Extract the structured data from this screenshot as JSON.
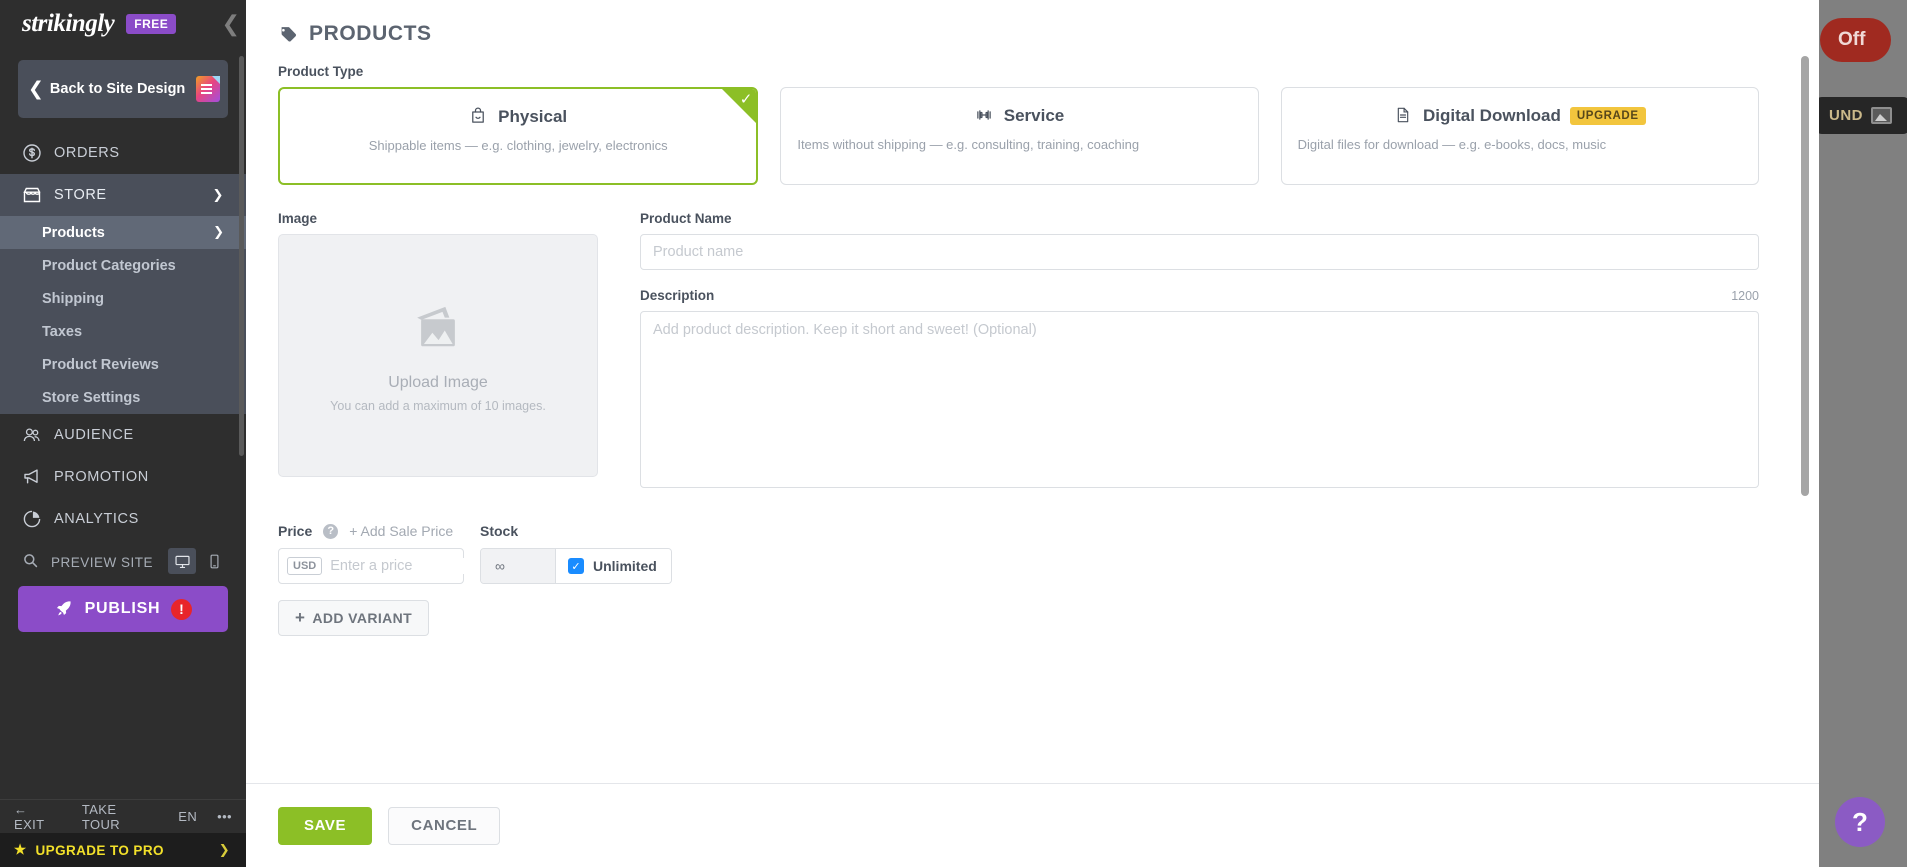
{
  "background": {
    "off_pill_label": "Off",
    "dark_button_label": "UND",
    "help_button_label": "?"
  },
  "sidebar": {
    "brand_name": "strikingly",
    "plan_badge": "FREE",
    "back_tile": {
      "label": "Back to Site Design"
    },
    "nav": [
      {
        "label": "ORDERS",
        "icon": "dollar-coin-icon",
        "active": false,
        "expanded": false
      },
      {
        "label": "STORE",
        "icon": "store-icon",
        "active": true,
        "expanded": true
      },
      {
        "label": "AUDIENCE",
        "icon": "people-icon",
        "active": false,
        "expanded": false
      },
      {
        "label": "PROMOTION",
        "icon": "megaphone-icon",
        "active": false,
        "expanded": false
      },
      {
        "label": "ANALYTICS",
        "icon": "pie-chart-icon",
        "active": false,
        "expanded": false
      }
    ],
    "store_subitems": [
      {
        "label": "Products",
        "selected": true
      },
      {
        "label": "Product Categories",
        "selected": false
      },
      {
        "label": "Shipping",
        "selected": false
      },
      {
        "label": "Taxes",
        "selected": false
      },
      {
        "label": "Product Reviews",
        "selected": false
      },
      {
        "label": "Store Settings",
        "selected": false
      }
    ],
    "preview": {
      "label": "PREVIEW SITE"
    },
    "publish": {
      "label": "PUBLISH",
      "alert": "!"
    },
    "footer": {
      "exit": "EXIT",
      "take_tour": "TAKE TOUR",
      "language": "EN",
      "more": "•••"
    },
    "upgrade": {
      "label": "UPGRADE TO PRO"
    }
  },
  "main": {
    "page_title": "PRODUCTS",
    "product_type": {
      "label": "Product Type",
      "options": [
        {
          "name": "Physical",
          "description": "Shippable items — e.g. clothing, jewelry, electronics",
          "icon": "shopping-bag-icon",
          "selected": true,
          "badge": ""
        },
        {
          "name": "Service",
          "description": "Items without shipping — e.g. consulting, training, coaching",
          "icon": "dumbbell-icon",
          "selected": false,
          "badge": ""
        },
        {
          "name": "Digital Download",
          "description": "Digital files for download — e.g. e-books, docs, music",
          "icon": "document-icon",
          "selected": false,
          "badge": "UPGRADE"
        }
      ]
    },
    "image": {
      "label": "Image",
      "upload_title": "Upload Image",
      "upload_hint": "You can add a maximum of 10 images."
    },
    "product_name": {
      "label": "Product Name",
      "placeholder": "Product name",
      "value": ""
    },
    "description": {
      "label": "Description",
      "char_limit": "1200",
      "placeholder": "Add product description. Keep it short and sweet! (Optional)",
      "value": ""
    },
    "price": {
      "label": "Price",
      "help": "?",
      "add_sale_price": "+ Add Sale Price",
      "currency": "USD",
      "placeholder": "Enter a price",
      "value": ""
    },
    "stock": {
      "label": "Stock",
      "quantity": "∞",
      "unlimited_label": "Unlimited",
      "unlimited_checked": true
    },
    "add_variant_label": "ADD VARIANT",
    "footer": {
      "save": "SAVE",
      "cancel": "CANCEL"
    }
  },
  "colors": {
    "brand_purple": "#8b4cc8",
    "accent_green": "#8cbf26",
    "upgrade_yellow": "#f2c53d",
    "checkbox_blue": "#1a8cff",
    "alert_red": "#e8252a"
  }
}
